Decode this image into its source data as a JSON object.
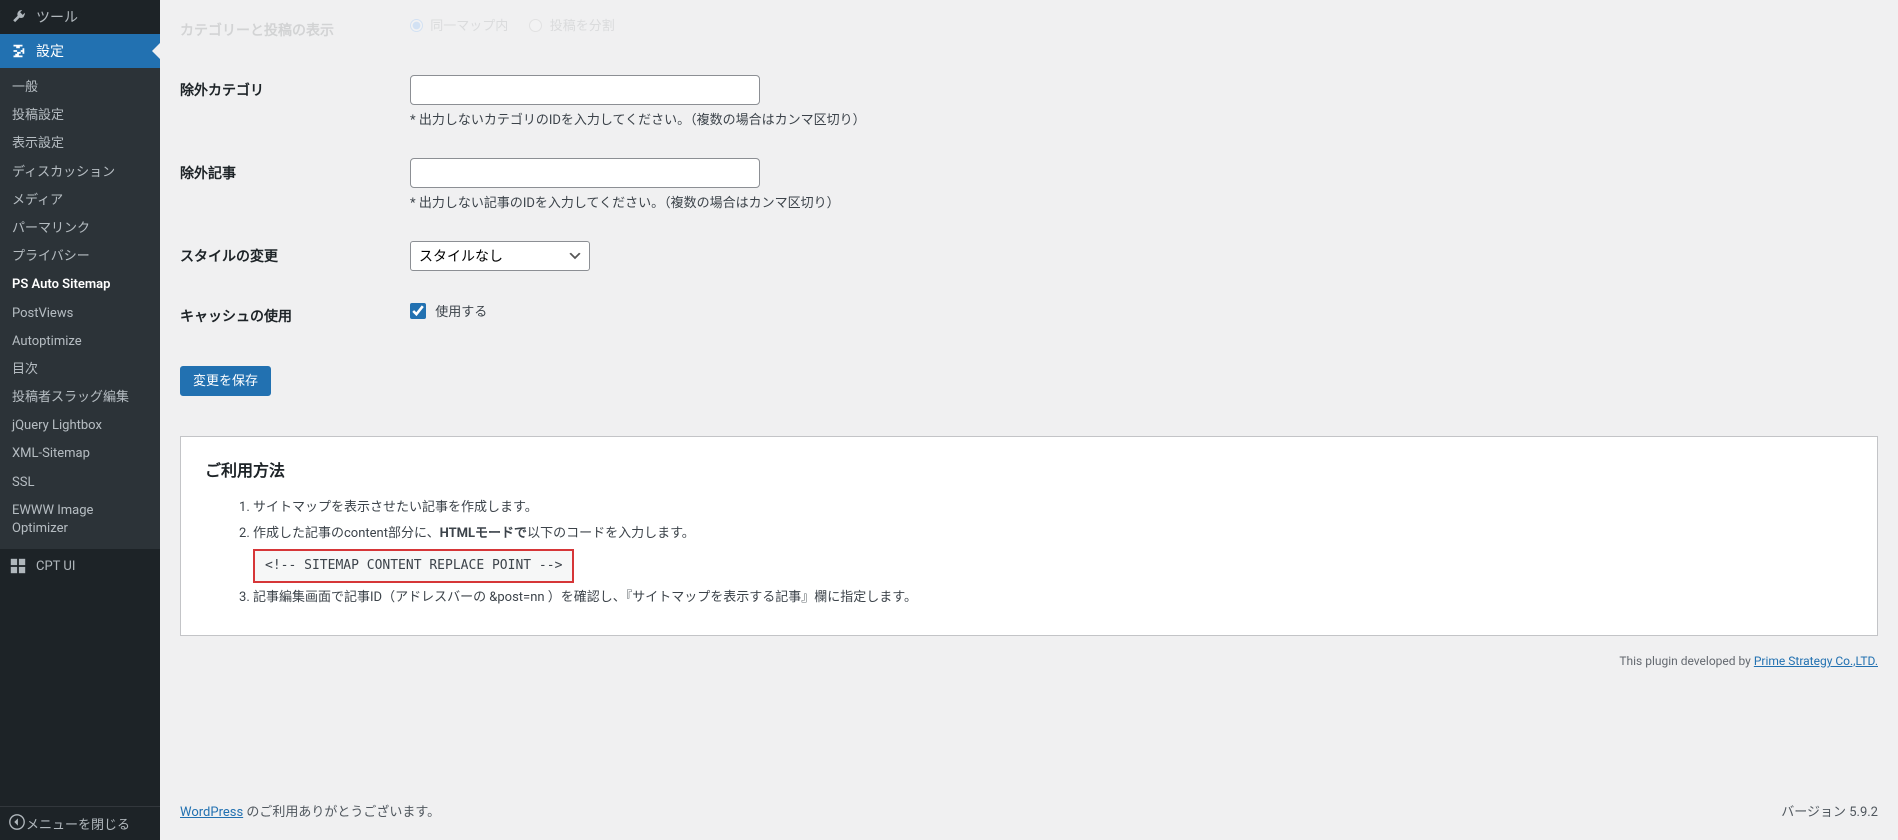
{
  "sidebar": {
    "tools_label": "ツール",
    "settings_label": "設定",
    "submenu": [
      {
        "label": "一般"
      },
      {
        "label": "投稿設定"
      },
      {
        "label": "表示設定"
      },
      {
        "label": "ディスカッション"
      },
      {
        "label": "メディア"
      },
      {
        "label": "パーマリンク"
      },
      {
        "label": "プライバシー"
      },
      {
        "label": "PS Auto Sitemap",
        "active": true
      },
      {
        "label": "PostViews"
      },
      {
        "label": "Autoptimize"
      },
      {
        "label": "目次"
      },
      {
        "label": "投稿者スラッグ編集"
      },
      {
        "label": "jQuery Lightbox"
      },
      {
        "label": "XML-Sitemap"
      },
      {
        "label": "SSL"
      },
      {
        "label": "EWWW Image Optimizer"
      }
    ],
    "cpt_label": "CPT UI",
    "collapse_label": "メニューを閉じる"
  },
  "form": {
    "cut_heading": "カテゴリーと投稿の表示",
    "cut_radio1": "同一マップ内",
    "cut_radio2": "投稿を分割",
    "exclude_cat": {
      "label": "除外カテゴリ",
      "desc": "* 出力しないカテゴリのIDを入力してください。（複数の場合はカンマ区切り）"
    },
    "exclude_post": {
      "label": "除外記事",
      "desc": "* 出力しない記事のIDを入力してください。（複数の場合はカンマ区切り）"
    },
    "style": {
      "label": "スタイルの変更",
      "option": "スタイルなし"
    },
    "cache": {
      "label": "キャッシュの使用",
      "checkbox_label": "使用する",
      "checked": true
    },
    "submit": "変更を保存"
  },
  "usage": {
    "title": "ご利用方法",
    "item1": "サイトマップを表示させたい記事を作成します。",
    "item2_pre": "作成した記事のcontent部分に、",
    "item2_bold": "HTMLモードで",
    "item2_post": "以下のコードを入力します。",
    "code": "<!-- SITEMAP CONTENT REPLACE POINT -->",
    "item3": "記事編集画面で記事ID（アドレスバーの &post=nn ）を確認し、『サイトマップを表示する記事』欄に指定します。"
  },
  "credit": {
    "text": "This plugin developed by ",
    "link": "Prime Strategy Co.,LTD."
  },
  "footer": {
    "wp_link": "WordPress",
    "thanks": " のご利用ありがとうございます。",
    "version": "バージョン 5.9.2"
  }
}
